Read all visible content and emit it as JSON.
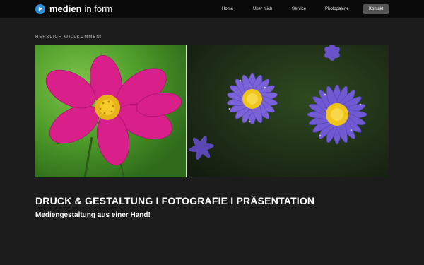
{
  "header": {
    "brand_strong": "medien",
    "brand_rest": "in form",
    "nav": [
      {
        "label": "Home"
      },
      {
        "label": "Über mich"
      },
      {
        "label": "Service"
      },
      {
        "label": "Photogalerie"
      },
      {
        "label": "Kontakt"
      }
    ]
  },
  "main": {
    "welcome": "HERZLICH WILLKOMMEN!",
    "headline": "DRUCK & GESTALTUNG I FOTOGRAFIE I PRÄSENTATION",
    "subline": "Mediengestaltung aus einer Hand!"
  },
  "hero": {
    "left_image": "pink-cosmos-flower",
    "right_image": "purple-aster-flowers"
  },
  "colors": {
    "background": "#1c1c1c",
    "topbar": "#0a0a0a",
    "accent": "#2a8fd6",
    "contact_button": "#555555"
  }
}
